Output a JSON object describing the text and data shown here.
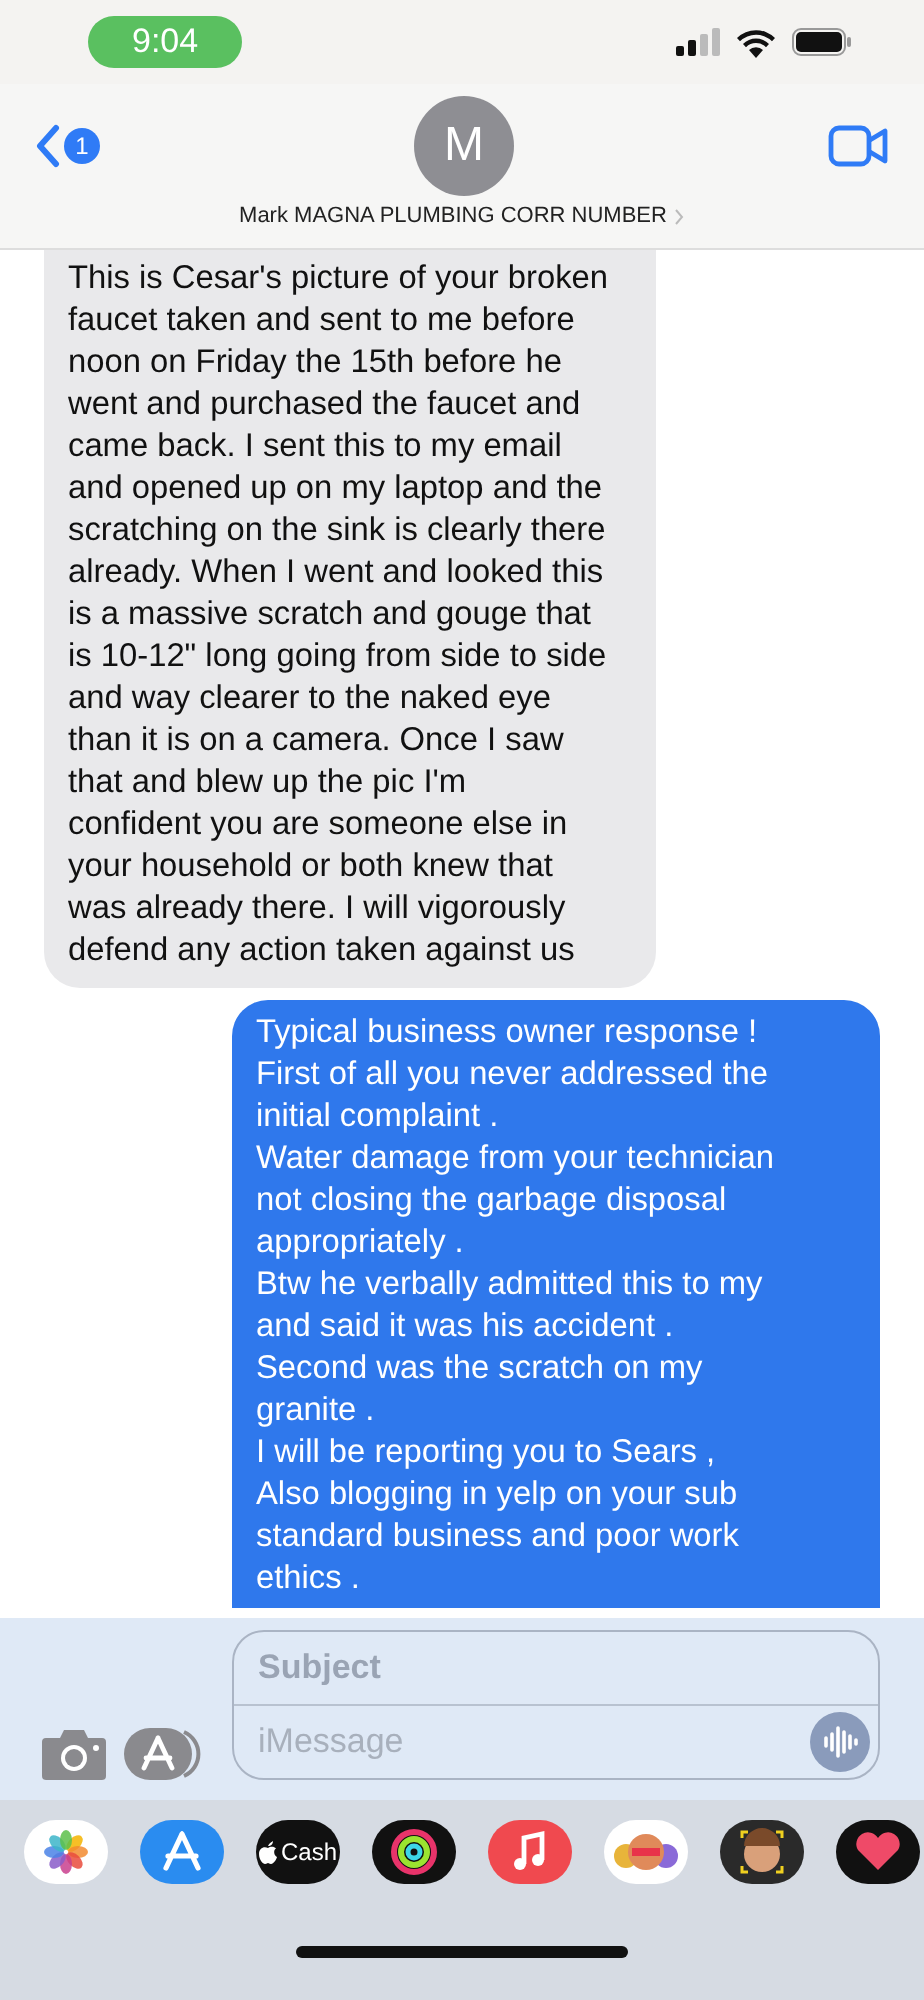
{
  "status_bar": {
    "time": "9:04"
  },
  "header": {
    "back_badge": "1",
    "avatar_letter": "M",
    "contact_name": "Mark MAGNA PLUMBING CORR NUMBER"
  },
  "messages": [
    {
      "kind": "received",
      "text": "This is Cesar's picture of your broken\nfaucet taken and sent to me before\nnoon on Friday the 15th before he\nwent and purchased the faucet and\ncame back. I sent this to my email\nand opened up on my laptop and the\nscratching on the sink is clearly there\nalready. When I went and looked this\nis a massive scratch and gouge that\nis 10-12\" long going from side to side\nand way clearer to the naked eye\nthan it is on a camera. Once I saw\nthat and blew up the pic I'm\nconfident you are someone else in\nyour household or both knew that\nwas already there. I will vigorously\ndefend any action taken against us"
    },
    {
      "kind": "sent",
      "text": "Typical business owner response !\nFirst of all you never addressed the\ninitial complaint .\nWater damage from your technician\nnot closing the garbage disposal\nappropriately .\nBtw he verbally admitted this to my\nand said it was his accident .\nSecond was the scratch on my\ngranite .\nI will be reporting you to Sears ,\nAlso blogging in yelp on your sub\nstandard business and poor work\nethics ."
    }
  ],
  "composer": {
    "subject_placeholder": "Subject",
    "message_placeholder": "iMessage"
  },
  "apps": [
    {
      "kind": "photos"
    },
    {
      "kind": "appstore"
    },
    {
      "kind": "cash",
      "label": "Cash"
    },
    {
      "kind": "activity"
    },
    {
      "kind": "music"
    },
    {
      "kind": "memoji"
    },
    {
      "kind": "memoji-face"
    },
    {
      "kind": "heart"
    }
  ]
}
